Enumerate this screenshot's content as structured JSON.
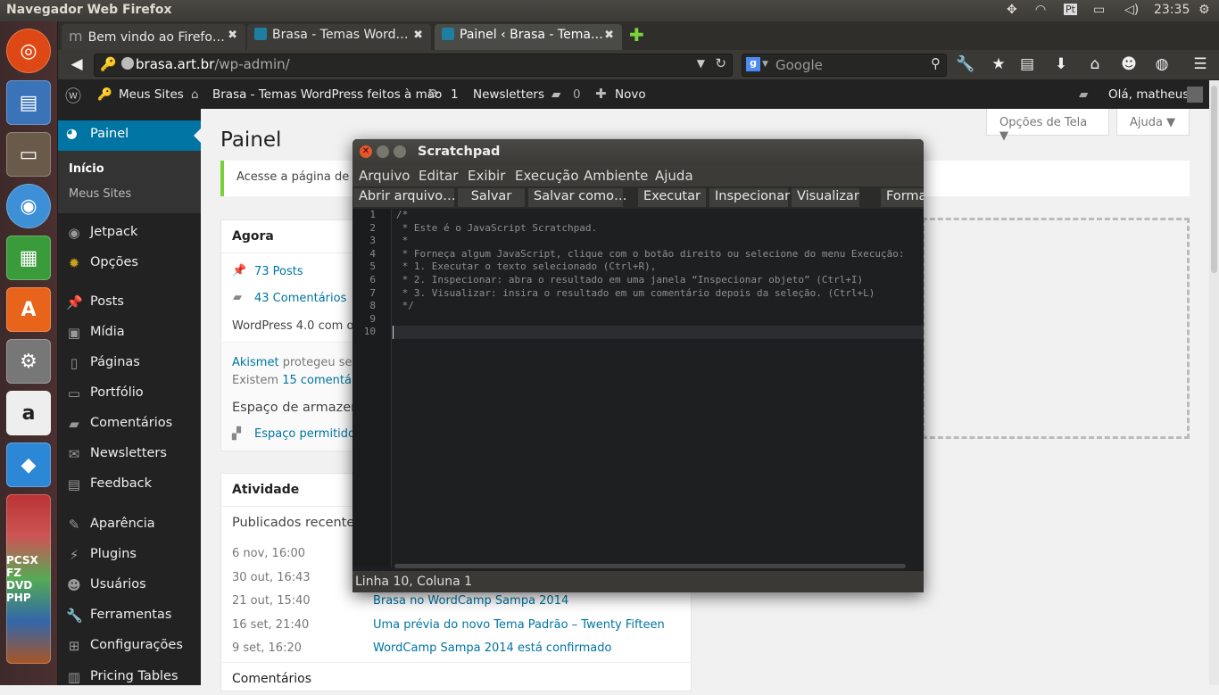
{
  "os_panel": {
    "title": "Navegador Web Firefox",
    "keyboard": "Pt",
    "time": "23:35"
  },
  "tabs": [
    {
      "label": "Bem vindo ao Firefo…",
      "active": false
    },
    {
      "label": "Brasa - Temas Word…",
      "active": false
    },
    {
      "label": "Painel ‹ Brasa - Tema…",
      "active": true
    }
  ],
  "url": {
    "host": "brasa.art.br",
    "path": "/wp-admin/"
  },
  "search": {
    "placeholder": "Google"
  },
  "admin_bar": {
    "my_sites": "Meus Sites",
    "site_name": "Brasa - Temas WordPress feitos à mão",
    "updates": "1",
    "newsletters": "Newsletters",
    "comments": "0",
    "new": "Novo",
    "greeting": "Olá, matheus"
  },
  "sidebar": {
    "active": "Painel",
    "submenu": [
      "Início",
      "Meus Sites"
    ],
    "items": [
      {
        "label": "Jetpack",
        "icon": "jetpack-icon"
      },
      {
        "label": "Opções",
        "icon": "gear-icon"
      },
      {
        "label": "Posts",
        "icon": "pin-icon"
      },
      {
        "label": "Mídia",
        "icon": "media-icon"
      },
      {
        "label": "Páginas",
        "icon": "pages-icon"
      },
      {
        "label": "Portfólio",
        "icon": "folder-icon"
      },
      {
        "label": "Comentários",
        "icon": "comment-icon"
      },
      {
        "label": "Newsletters",
        "icon": "mail-icon"
      },
      {
        "label": "Feedback",
        "icon": "feedback-icon"
      },
      {
        "label": "Aparência",
        "icon": "brush-icon"
      },
      {
        "label": "Plugins",
        "icon": "plugin-icon"
      },
      {
        "label": "Usuários",
        "icon": "user-icon"
      },
      {
        "label": "Ferramentas",
        "icon": "wrench-icon"
      },
      {
        "label": "Configurações",
        "icon": "settings-icon"
      },
      {
        "label": "Pricing Tables",
        "icon": "chart-icon"
      }
    ]
  },
  "main": {
    "title": "Painel",
    "screen_options": "Opções de Tela ▼",
    "help": "Ajuda ▼",
    "notice": "Acesse a página de Su",
    "now": {
      "title": "Agora",
      "posts": "73 Posts",
      "comments": "43 Comentários",
      "version": "WordPress 4.0 com o te",
      "akismet_link": "Akismet",
      "akismet_text": " protegeu seu s",
      "pending_pre": "Existem ",
      "pending_link": "15 comentário",
      "storage_title": "Espaço de armazena",
      "storage_link": "Espaço permitido:"
    },
    "activity": {
      "title": "Atividade",
      "subtitle": "Publicados recenten",
      "rows": [
        {
          "date": "6 nov, 16:00",
          "title": ""
        },
        {
          "date": "30 out, 16:43",
          "title": ""
        },
        {
          "date": "21 out, 15:40",
          "title": "Brasa no WordCamp Sampa 2014"
        },
        {
          "date": "16 set, 21:40",
          "title": "Uma prévia do novo Tema Padrão – Twenty Fifteen"
        },
        {
          "date": "9 set, 16:20",
          "title": "WordCamp Sampa 2014 está confirmado"
        }
      ],
      "comments_title": "Comentários"
    }
  },
  "scratchpad": {
    "title": "Scratchpad",
    "menu": [
      "Arquivo",
      "Editar",
      "Exibir",
      "Execução",
      "Ambiente",
      "Ajuda"
    ],
    "toolbar": [
      "Abrir arquivo…",
      "Salvar",
      "Salvar como…",
      "Executar",
      "Inspecionar",
      "Visualizar",
      "Forma"
    ],
    "lines": [
      "/*",
      " * Este é o JavaScript Scratchpad.",
      " *",
      " * Forneça algum JavaScript, clique com o botão direito ou selecione do menu Execução:",
      " * 1. Executar o texto selecionado (Ctrl+R),",
      " * 2. Inspecionar: abra o resultado em uma janela “Inspecionar objeto” (Ctrl+I)",
      " * 3. Visualizar: insira o resultado em um comentário depois da seleção. (Ctrl+L)",
      " */",
      "",
      ""
    ],
    "status": "Linha 10, Coluna 1"
  }
}
